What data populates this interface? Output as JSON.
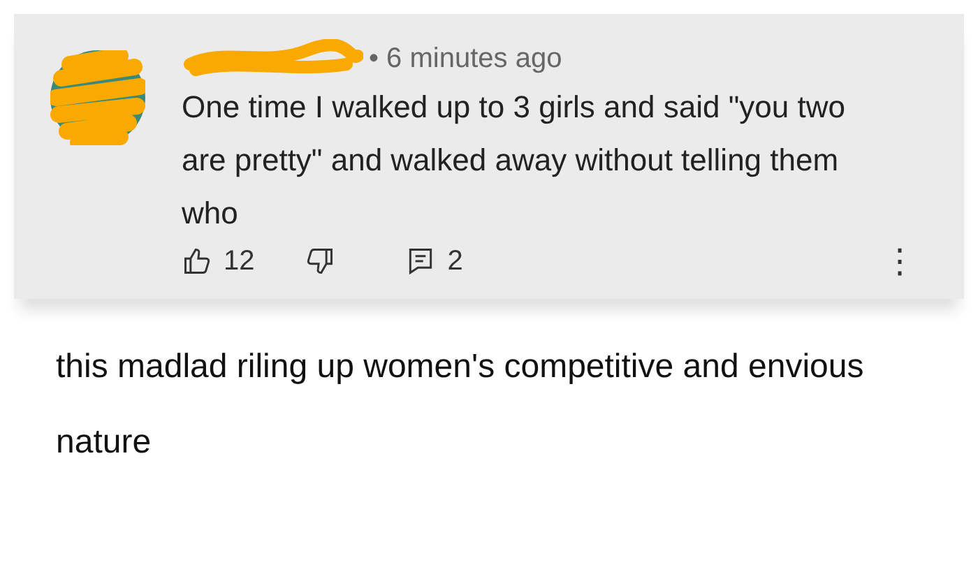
{
  "comment": {
    "author_redacted": true,
    "time": "• 6 minutes ago",
    "text": "One time I walked up to 3 girls and said \"you two are pretty\" and walked away without telling them who",
    "likes": "12",
    "replies": "2",
    "menu": "⋮"
  },
  "caption": "this madlad riling up women's competitive and envious nature"
}
